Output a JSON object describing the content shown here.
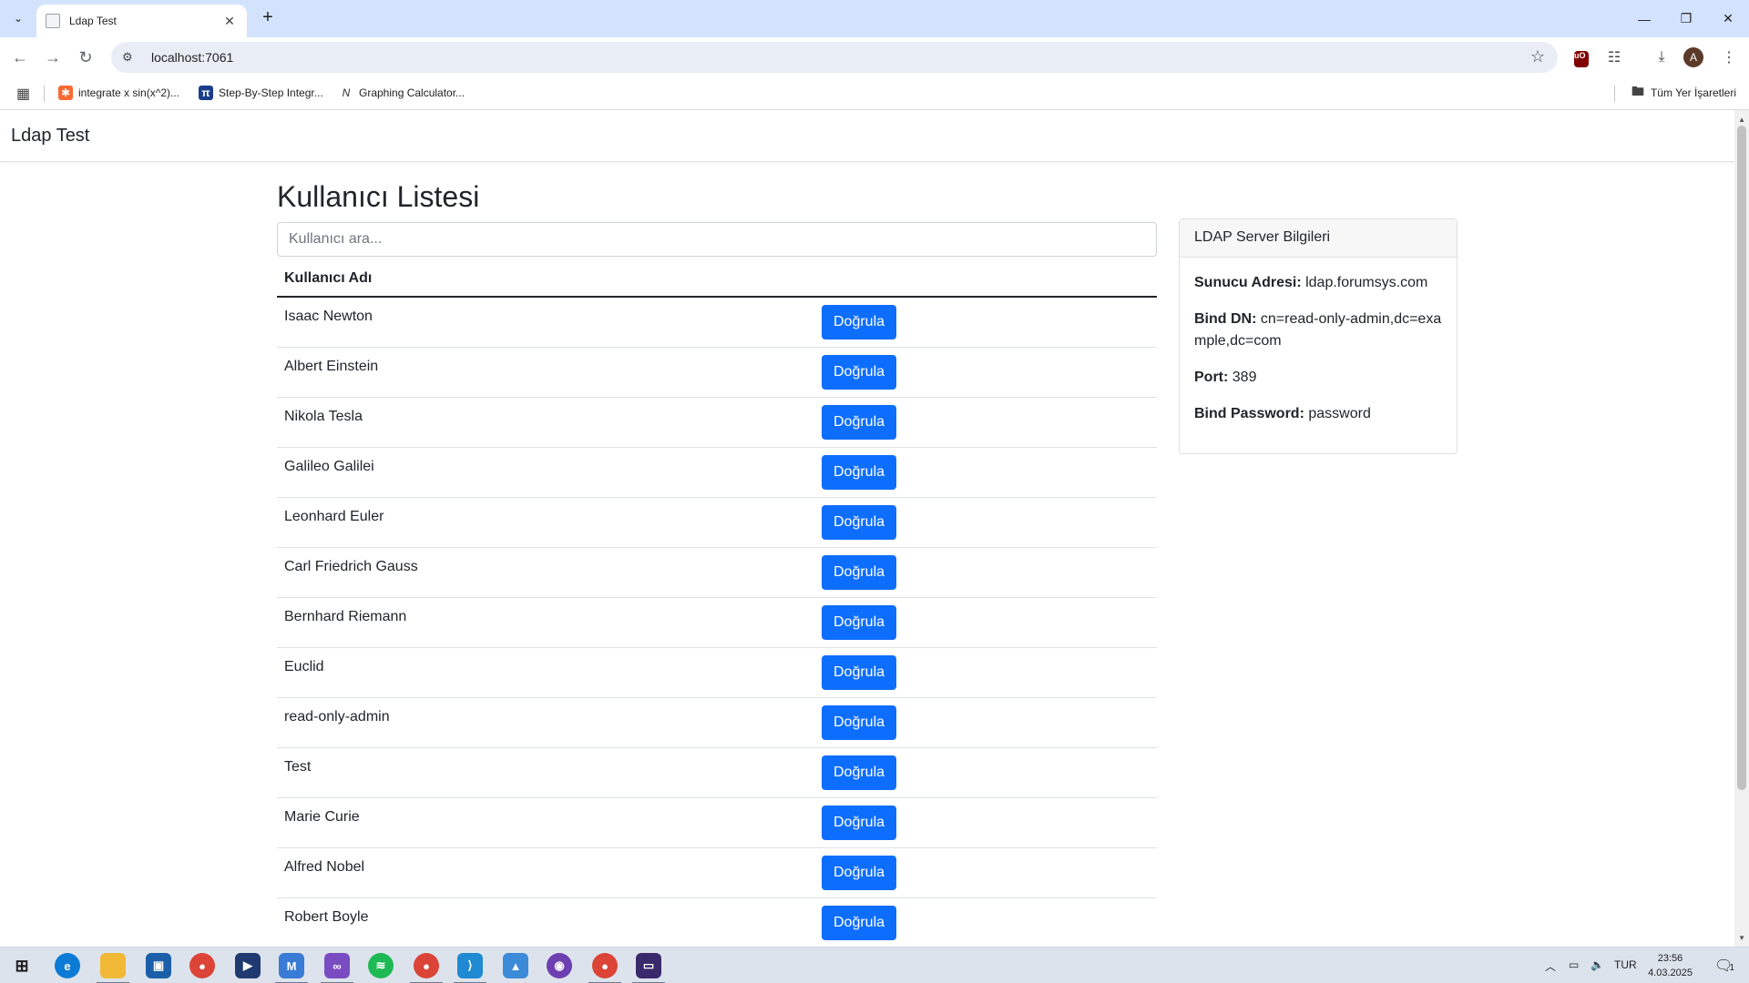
{
  "browser": {
    "tab_title": "Ldap Test",
    "url": "localhost:7061",
    "bookmarks": [
      {
        "label": "integrate x sin(x^2)...",
        "icon": "wolfram-icon",
        "color": "#f96932"
      },
      {
        "label": "Step-By-Step Integr...",
        "icon": "pi-icon",
        "color": "#1a3e8c"
      },
      {
        "label": "Graphing Calculator...",
        "icon": "desmos-icon",
        "color": "#2d2d2d"
      }
    ],
    "all_bookmarks_label": "Tüm Yer İşaretleri"
  },
  "navbar": {
    "brand": "Ldap Test"
  },
  "main": {
    "title": "Kullanıcı Listesi",
    "search_placeholder": "Kullanıcı ara...",
    "table_header": "Kullanıcı Adı",
    "verify_label": "Doğrula",
    "users": [
      "Isaac Newton",
      "Albert Einstein",
      "Nikola Tesla",
      "Galileo Galilei",
      "Leonhard Euler",
      "Carl Friedrich Gauss",
      "Bernhard Riemann",
      "Euclid",
      "read-only-admin",
      "Test",
      "Marie Curie",
      "Alfred Nobel",
      "Robert Boyle"
    ]
  },
  "server_card": {
    "header": "LDAP Server Bilgileri",
    "address_label": "Sunucu Adresi:",
    "address_value": "ldap.forumsys.com",
    "bind_dn_label": "Bind DN:",
    "bind_dn_value": "cn=read-only-admin,dc=example,dc=com",
    "port_label": "Port:",
    "port_value": "389",
    "password_label": "Bind Password:",
    "password_value": "password"
  },
  "taskbar": {
    "language": "TUR",
    "time": "23:56",
    "date": "4.03.2025",
    "notification_count": "1"
  },
  "colors": {
    "primary": "#0d6efd",
    "tabbar": "#d3e3fd"
  }
}
